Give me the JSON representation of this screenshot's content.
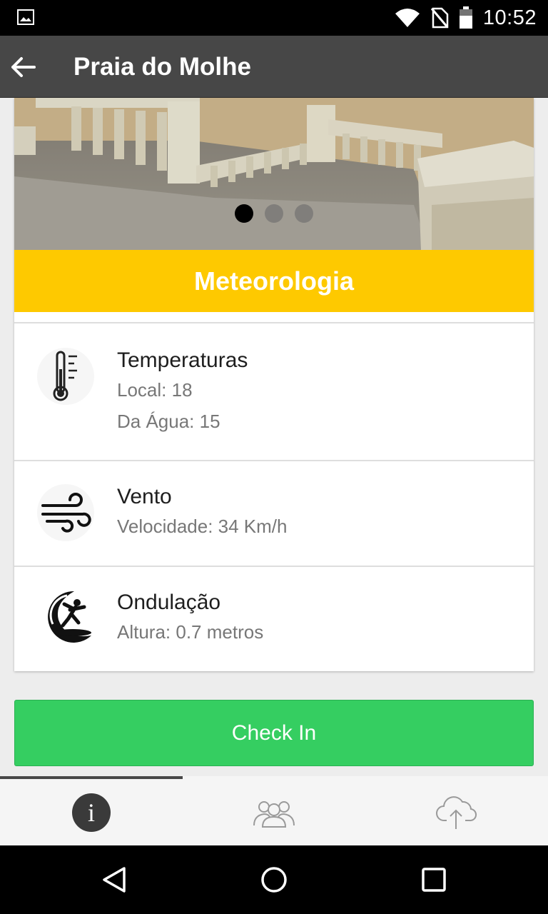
{
  "status_bar": {
    "time": "10:52",
    "icons": [
      "gallery-notification-icon",
      "wifi-icon",
      "no-sim-icon",
      "battery-icon"
    ]
  },
  "app_bar": {
    "title": "Praia do Molhe",
    "back_icon": "arrow-back-icon"
  },
  "carousel": {
    "slide_count": 3,
    "active_index": 0
  },
  "meteorology": {
    "title": "Meteorologia",
    "items": [
      {
        "icon": "thermometer-icon",
        "heading": "Temperaturas",
        "lines": [
          "Local: 18",
          "Da Água: 15"
        ]
      },
      {
        "icon": "wind-icon",
        "heading": "Vento",
        "lines": [
          "Velocidade: 34 Km/h"
        ]
      },
      {
        "icon": "surfer-wave-icon",
        "heading": "Ondulação",
        "lines": [
          "Altura: 0.7 metros"
        ]
      }
    ]
  },
  "check_in": {
    "label": "Check In"
  },
  "tabs": [
    {
      "icon": "info-icon",
      "glyph": "i",
      "active": true
    },
    {
      "icon": "people-group-icon",
      "active": false
    },
    {
      "icon": "cloud-upload-icon",
      "active": false
    }
  ],
  "nav": [
    "back-triangle-icon",
    "home-circle-icon",
    "recents-square-icon"
  ],
  "colors": {
    "app_bar": "#474747",
    "section_header": "#fec900",
    "check_in": "#35ce61",
    "tab_bar": "#f5f5f5"
  }
}
